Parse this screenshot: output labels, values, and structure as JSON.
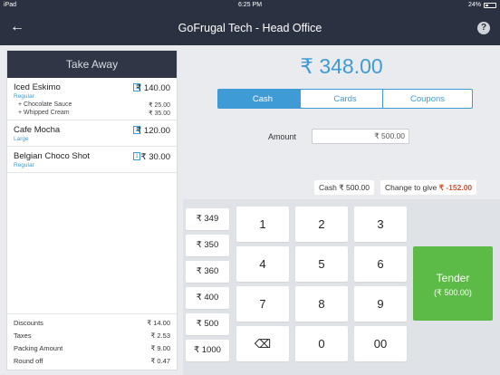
{
  "status_bar": {
    "device": "iPad",
    "time": "6:25 PM",
    "battery": "24%"
  },
  "header": {
    "title": "GoFrugal Tech - Head Office",
    "help_label": "?"
  },
  "order": {
    "type_label": "Take Away",
    "items": [
      {
        "name": "Iced Eskimo",
        "variant": "Regular",
        "qty": "1",
        "price": "₹ 140.00",
        "addons": [
          {
            "name": "+ Chocolate Sauce",
            "price": "₹ 25.00"
          },
          {
            "name": "+ Whipped Cream",
            "price": "₹ 35.00"
          }
        ]
      },
      {
        "name": "Cafe Mocha",
        "variant": "Large",
        "qty": "1",
        "price": "₹ 120.00",
        "addons": []
      },
      {
        "name": "Belgian Choco Shot",
        "variant": "Regular",
        "qty": "1",
        "price": "₹ 30.00",
        "addons": []
      }
    ],
    "totals": [
      {
        "label": "Discounts",
        "value": "₹ 14.00"
      },
      {
        "label": "Taxes",
        "value": "₹ 2.53"
      },
      {
        "label": "Packing Amount",
        "value": "₹ 9.00"
      },
      {
        "label": "Round off",
        "value": "₹ 0.47"
      }
    ]
  },
  "payment": {
    "total": "₹ 348.00",
    "tabs": [
      {
        "label": "Cash",
        "active": true
      },
      {
        "label": "Cards",
        "active": false
      },
      {
        "label": "Coupons",
        "active": false
      }
    ],
    "amount_label": "Amount",
    "amount_value": "₹ 500.00",
    "cash_label": "Cash",
    "cash_value": "₹ 500.00",
    "change_label": "Change to give",
    "change_value": "₹ -152.00",
    "quick_amounts": [
      "₹ 349",
      "₹ 350",
      "₹ 360",
      "₹ 400",
      "₹ 500",
      "₹ 1000"
    ],
    "keys": [
      "1",
      "2",
      "3",
      "4",
      "5",
      "6",
      "7",
      "8",
      "9",
      "⌫",
      "0",
      "00"
    ],
    "tender_label": "Tender",
    "tender_amount": "(₹ 500.00)"
  }
}
